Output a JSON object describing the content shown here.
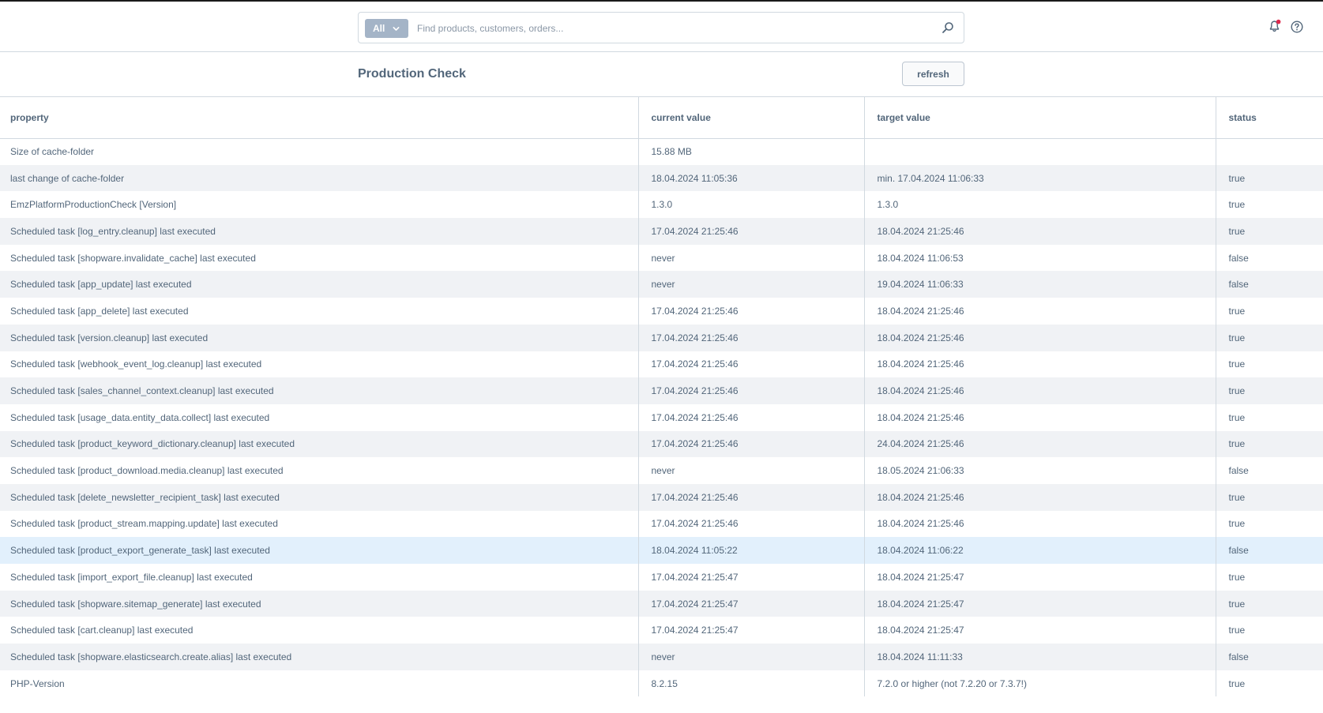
{
  "search": {
    "type_label": "All",
    "placeholder": "Find products, customers, orders..."
  },
  "page": {
    "title": "Production Check",
    "refresh_label": "refresh"
  },
  "table": {
    "headers": {
      "property": "property",
      "current": "current value",
      "target": "target value",
      "status": "status"
    },
    "rows": [
      {
        "property": "Size of cache-folder",
        "current": "15.88 MB",
        "target": "",
        "status": ""
      },
      {
        "property": "last change of cache-folder",
        "current": "18.04.2024 11:05:36",
        "target": "min. 17.04.2024 11:06:33",
        "status": "true"
      },
      {
        "property": "EmzPlatformProductionCheck [Version]",
        "current": "1.3.0",
        "target": "1.3.0",
        "status": "true"
      },
      {
        "property": "Scheduled task [log_entry.cleanup] last executed",
        "current": "17.04.2024 21:25:46",
        "target": "18.04.2024 21:25:46",
        "status": "true"
      },
      {
        "property": "Scheduled task [shopware.invalidate_cache] last executed",
        "current": "never",
        "target": "18.04.2024 11:06:53",
        "status": "false"
      },
      {
        "property": "Scheduled task [app_update] last executed",
        "current": "never",
        "target": "19.04.2024 11:06:33",
        "status": "false"
      },
      {
        "property": "Scheduled task [app_delete] last executed",
        "current": "17.04.2024 21:25:46",
        "target": "18.04.2024 21:25:46",
        "status": "true"
      },
      {
        "property": "Scheduled task [version.cleanup] last executed",
        "current": "17.04.2024 21:25:46",
        "target": "18.04.2024 21:25:46",
        "status": "true"
      },
      {
        "property": "Scheduled task [webhook_event_log.cleanup] last executed",
        "current": "17.04.2024 21:25:46",
        "target": "18.04.2024 21:25:46",
        "status": "true"
      },
      {
        "property": "Scheduled task [sales_channel_context.cleanup] last executed",
        "current": "17.04.2024 21:25:46",
        "target": "18.04.2024 21:25:46",
        "status": "true"
      },
      {
        "property": "Scheduled task [usage_data.entity_data.collect] last executed",
        "current": "17.04.2024 21:25:46",
        "target": "18.04.2024 21:25:46",
        "status": "true"
      },
      {
        "property": "Scheduled task [product_keyword_dictionary.cleanup] last executed",
        "current": "17.04.2024 21:25:46",
        "target": "24.04.2024 21:25:46",
        "status": "true"
      },
      {
        "property": "Scheduled task [product_download.media.cleanup] last executed",
        "current": "never",
        "target": "18.05.2024 21:06:33",
        "status": "false"
      },
      {
        "property": "Scheduled task [delete_newsletter_recipient_task] last executed",
        "current": "17.04.2024 21:25:46",
        "target": "18.04.2024 21:25:46",
        "status": "true"
      },
      {
        "property": "Scheduled task [product_stream.mapping.update] last executed",
        "current": "17.04.2024 21:25:46",
        "target": "18.04.2024 21:25:46",
        "status": "true"
      },
      {
        "property": "Scheduled task [product_export_generate_task] last executed",
        "current": "18.04.2024 11:05:22",
        "target": "18.04.2024 11:06:22",
        "status": "false"
      },
      {
        "property": "Scheduled task [import_export_file.cleanup] last executed",
        "current": "17.04.2024 21:25:47",
        "target": "18.04.2024 21:25:47",
        "status": "true"
      },
      {
        "property": "Scheduled task [shopware.sitemap_generate] last executed",
        "current": "17.04.2024 21:25:47",
        "target": "18.04.2024 21:25:47",
        "status": "true"
      },
      {
        "property": "Scheduled task [cart.cleanup] last executed",
        "current": "17.04.2024 21:25:47",
        "target": "18.04.2024 21:25:47",
        "status": "true"
      },
      {
        "property": "Scheduled task [shopware.elasticsearch.create.alias] last executed",
        "current": "never",
        "target": "18.04.2024 11:11:33",
        "status": "false"
      },
      {
        "property": "PHP-Version",
        "current": "8.2.15",
        "target": "7.2.0 or higher (not 7.2.20 or 7.3.7!)",
        "status": "true"
      }
    ],
    "highlighted_row": 15
  },
  "colors": {
    "text": "#52667a",
    "border": "#d1d9e0",
    "row_alt": "#f0f2f5",
    "row_highlight": "#e2f0fc",
    "notification_dot": "#de294c"
  },
  "icons": [
    "search-icon",
    "chevron-down-icon",
    "bell-icon",
    "help-icon"
  ]
}
